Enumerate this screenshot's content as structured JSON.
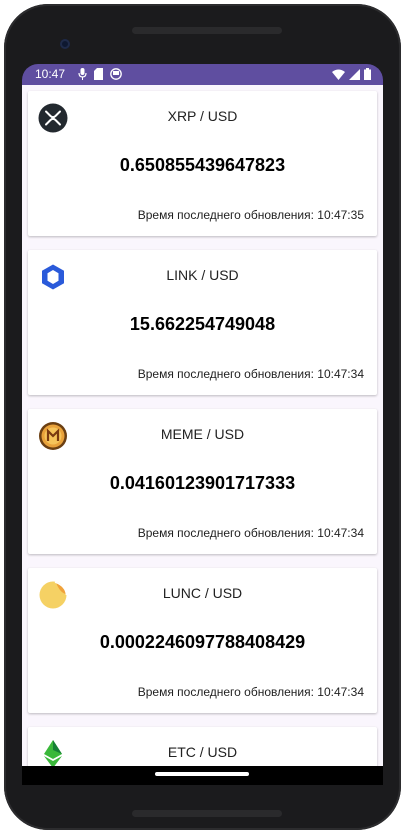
{
  "status": {
    "time": "10:47"
  },
  "cards": [
    {
      "icon": "xrp-icon",
      "pair": "XRP / USD",
      "price": "0.650855439647823",
      "updated": "Время последнего обновления: 10:47:35"
    },
    {
      "icon": "link-icon",
      "pair": "LINK / USD",
      "price": "15.662254749048",
      "updated": "Время последнего обновления: 10:47:34"
    },
    {
      "icon": "meme-icon",
      "pair": "MEME / USD",
      "price": "0.04160123901717333",
      "updated": "Время последнего обновления: 10:47:34"
    },
    {
      "icon": "lunc-icon",
      "pair": "LUNC / USD",
      "price": "0.0002246097788408429",
      "updated": "Время последнего обновления: 10:47:34"
    },
    {
      "icon": "etc-icon",
      "pair": "ETC / USD",
      "price": "",
      "updated": ""
    }
  ],
  "colors": {
    "statusbar": "#5f4ea0",
    "background": "#faf6fd"
  }
}
